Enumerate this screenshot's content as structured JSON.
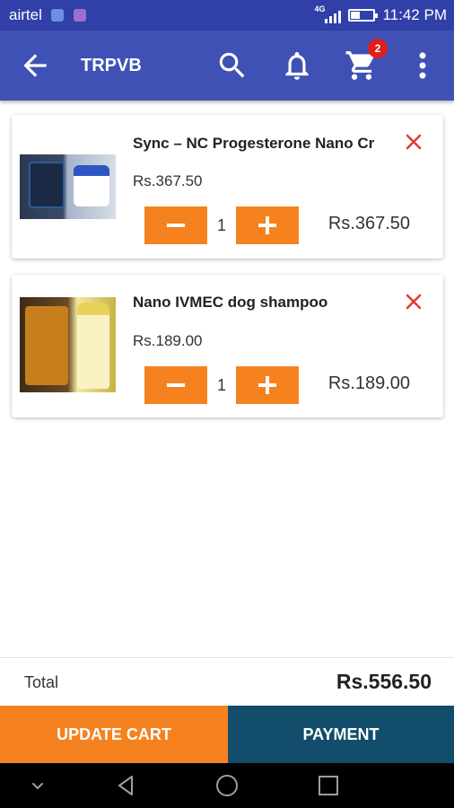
{
  "status_bar": {
    "carrier": "airtel",
    "network": "4G",
    "time": "11:42 PM",
    "battery_level": 0.35
  },
  "app_bar": {
    "title": "TRPVB",
    "cart_count": "2",
    "icons": [
      "back-arrow-icon",
      "search-icon",
      "bell-icon",
      "cart-icon",
      "more-vert-icon"
    ]
  },
  "cart": {
    "items": [
      {
        "name": "Sync – NC Progesterone Nano Cr",
        "price": "Rs.367.50",
        "quantity": "1",
        "line_total": "Rs.367.50"
      },
      {
        "name": "Nano IVMEC dog shampoo",
        "price": "Rs.189.00",
        "quantity": "1",
        "line_total": "Rs.189.00"
      }
    ]
  },
  "summary": {
    "total_label": "Total",
    "total_value": "Rs.556.50"
  },
  "actions": {
    "update_cart": "UPDATE CART",
    "payment": "PAYMENT"
  },
  "colors": {
    "primary": "#3f51b5",
    "status_bar": "#3140a8",
    "accent_orange": "#f5821f",
    "payment_blue": "#124d6b",
    "remove_red": "#e53935",
    "badge_red": "#e01e1e"
  }
}
